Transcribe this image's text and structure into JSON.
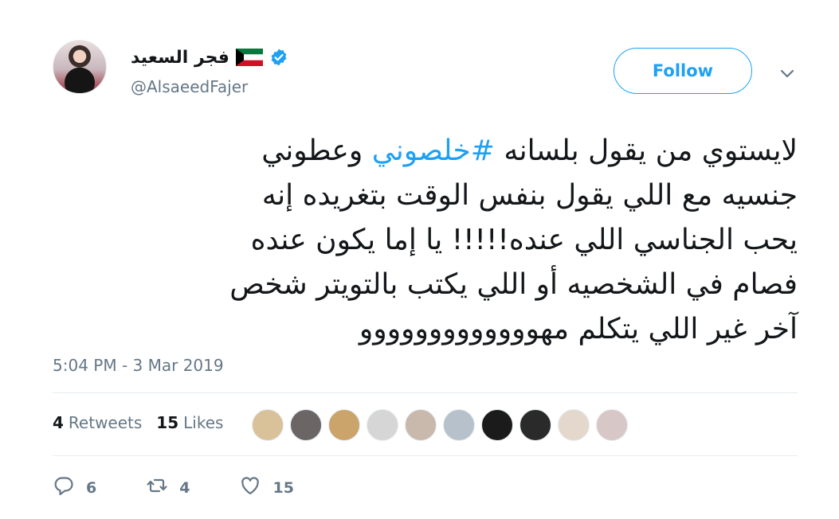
{
  "author": {
    "display_name": "فجر السعيد",
    "handle": "@AlsaeedFajer",
    "avatar_icon": "profile-avatar",
    "flag_icon": "kuwait-flag-icon",
    "verified_icon": "verified-badge-icon"
  },
  "follow_button": {
    "label": "Follow"
  },
  "tweet": {
    "lines": [
      {
        "before": "لايستوي من يقول بلسانه ",
        "hashtag": "#خلصوني",
        "after": " وعطوني"
      },
      {
        "text": "جنسيه مع اللي يقول بنفس الوقت بتغريده إنه"
      },
      {
        "text": "يحب الجناسي اللي عنده!!!!! يا إما يكون عنده"
      },
      {
        "text": "فصام في الشخصيه أو اللي يكتب بالتويتر شخص"
      },
      {
        "text": "آخر غير اللي يتكلم مهووووووووووووو"
      }
    ]
  },
  "timestamp": "5:04 PM - 3 Mar 2019",
  "stats": {
    "retweets_count": "4",
    "retweets_label": "Retweets",
    "likes_count": "15",
    "likes_label": "Likes"
  },
  "likers": [
    {
      "name": "liker-avatar-1",
      "color": "#d9c19a"
    },
    {
      "name": "liker-avatar-2",
      "color": "#6b6566"
    },
    {
      "name": "liker-avatar-3",
      "color": "#caa46a"
    },
    {
      "name": "liker-avatar-4",
      "color": "#d6d6d6"
    },
    {
      "name": "liker-avatar-5",
      "color": "#c9b9ad"
    },
    {
      "name": "liker-avatar-6",
      "color": "#b7c1cb"
    },
    {
      "name": "liker-avatar-7",
      "color": "#1b1b1b"
    },
    {
      "name": "liker-avatar-8",
      "color": "#2a2a2a"
    },
    {
      "name": "liker-avatar-9",
      "color": "#e4d8cc"
    },
    {
      "name": "liker-avatar-10",
      "color": "#d8c7c7"
    }
  ],
  "actions": {
    "reply_count": "6",
    "retweet_count": "4",
    "like_count": "15"
  },
  "colors": {
    "accent": "#1da1f2",
    "text_primary": "#14171a",
    "text_secondary": "#657786",
    "divider": "#e6ecf0"
  }
}
